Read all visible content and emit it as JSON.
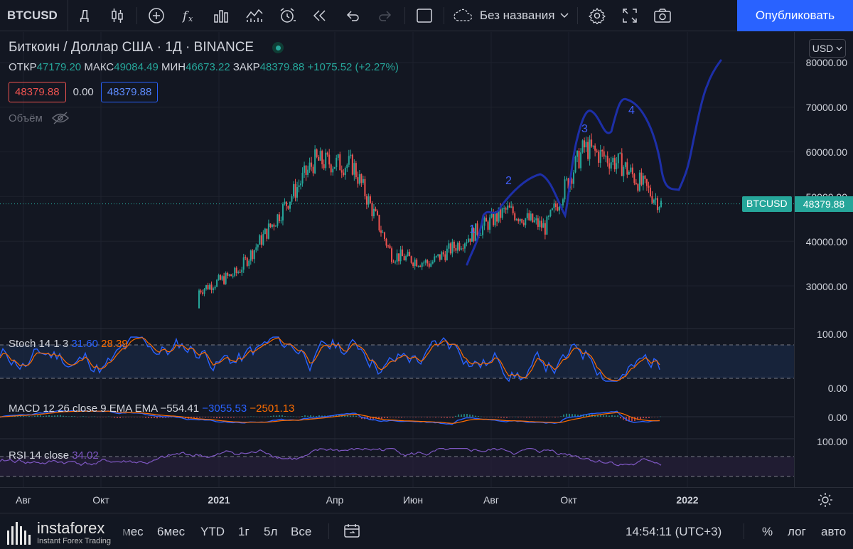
{
  "toolbar": {
    "symbol": "BTCUSD",
    "interval": "Д",
    "layout_name": "Без названия",
    "publish_label": "Опубликовать"
  },
  "legend": {
    "title": "Биткоин / Доллар США · 1Д · BINANCE",
    "open_label": "ОТКР",
    "open": "47179.20",
    "high_label": "МАКС",
    "high": "49084.49",
    "low_label": "МИН",
    "low": "46673.22",
    "close_label": "ЗАКР",
    "close": "48379.88",
    "change": "+1075.52 (+2.27%)",
    "bid": "48379.88",
    "spread": "0.00",
    "ask": "48379.88",
    "volume_label": "Объём"
  },
  "currency_select": "USD",
  "price_scale": {
    "ticks": [
      "80000.00",
      "70000.00",
      "60000.00",
      "50000.00",
      "40000.00",
      "30000.00"
    ],
    "current_symbol": "BTCUSD",
    "current_price": "48379.88"
  },
  "indicators": {
    "stoch": {
      "label": "Stoch 14 1 3",
      "k": "31.60",
      "d": "28.39",
      "tick_top": "100.00",
      "tick_bottom": "0.00"
    },
    "macd": {
      "label": "MACD 12 26 close 9 EMA EMA",
      "hist": "−554.41",
      "macd": "−3055.53",
      "signal": "−2501.13",
      "tick": "0.00"
    },
    "rsi": {
      "label": "RSI 14 close",
      "value": "34.02",
      "tick": "100.00"
    }
  },
  "wave_labels": [
    "1",
    "2",
    "3",
    "4"
  ],
  "time_axis": [
    "Авг",
    "Окт",
    "2021",
    "Апр",
    "Июн",
    "Авг",
    "Окт",
    "2022"
  ],
  "bottom_bar": {
    "ranges": [
      "6мес",
      "YTD",
      "1г",
      "5л",
      "Все"
    ],
    "partial_range": "мес",
    "clock": "14:54:11 (UTC+3)",
    "percent": "%",
    "log": "лог",
    "auto": "авто"
  },
  "watermark": {
    "name": "instaforex",
    "tagline": "Instant Forex Trading"
  },
  "colors": {
    "up": "#26a69a",
    "down": "#ef5350",
    "wave": "#1d2fa8",
    "accent": "#2962ff"
  },
  "chart_data": {
    "type": "candlestick",
    "symbol": "BTCUSD",
    "timeframe": "1D",
    "x": [
      "Авг",
      "Окт",
      "2021",
      "Апр",
      "Июн",
      "Авг",
      "Окт",
      "2022"
    ],
    "ylim": [
      25000,
      82000
    ],
    "approx_closes": [
      {
        "period": "2020-12",
        "value": 29000
      },
      {
        "period": "2021-01",
        "value": 33000
      },
      {
        "period": "2021-02",
        "value": 45000
      },
      {
        "period": "2021-03",
        "value": 58000
      },
      {
        "period": "2021-04",
        "value": 57000
      },
      {
        "period": "2021-05",
        "value": 37000
      },
      {
        "period": "2021-06",
        "value": 35000
      },
      {
        "period": "2021-07",
        "value": 41000
      },
      {
        "period": "2021-08",
        "value": 47000
      },
      {
        "period": "2021-09",
        "value": 43000
      },
      {
        "period": "2021-10",
        "value": 61000
      },
      {
        "period": "2021-11",
        "value": 57000
      },
      {
        "period": "2021-12",
        "value": 48380
      }
    ],
    "projection": {
      "wave_points": [
        35000,
        47000,
        38000,
        69000,
        61000,
        80000
      ]
    }
  }
}
